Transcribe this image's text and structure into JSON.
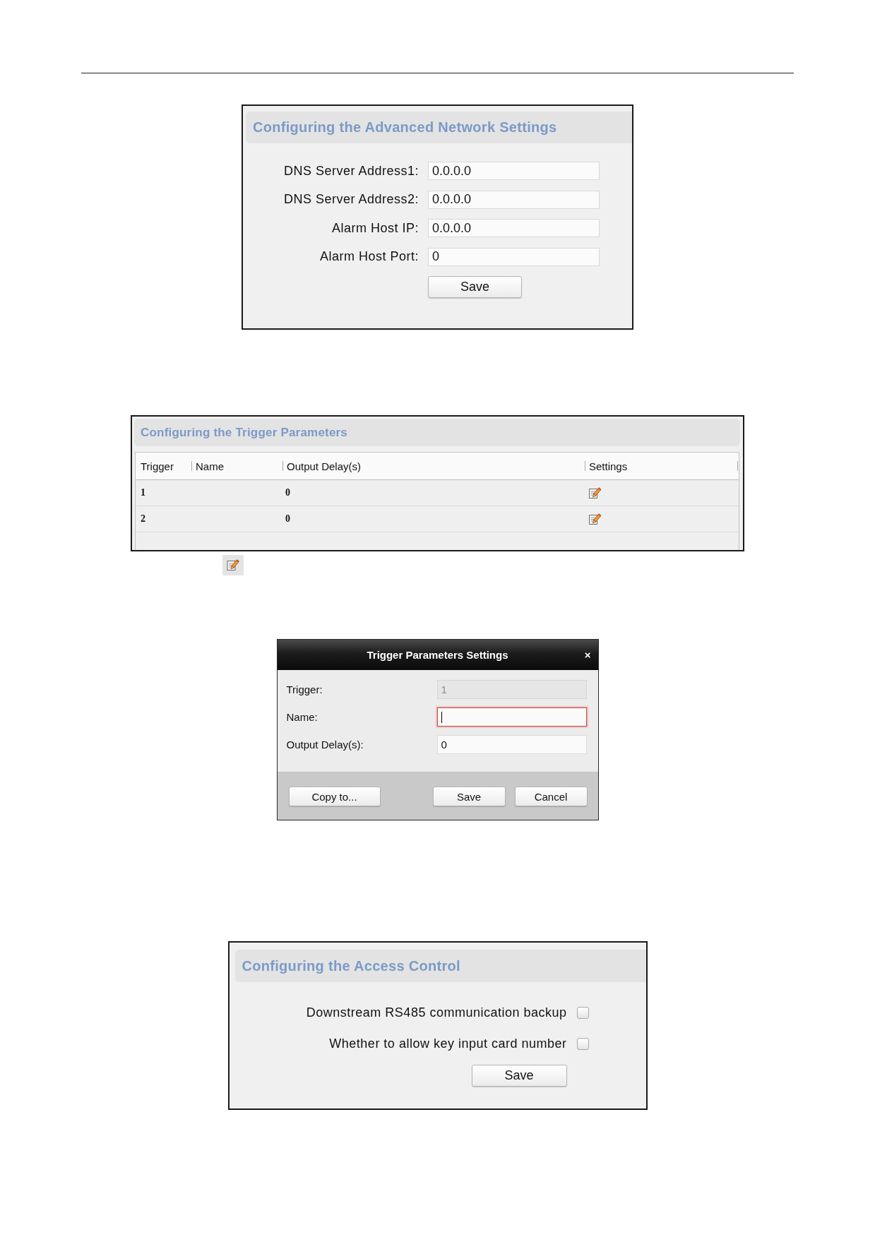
{
  "network_settings": {
    "title": "Configuring the Advanced Network Settings",
    "fields": [
      {
        "label": "DNS Server Address1:",
        "value": "0.0.0.0"
      },
      {
        "label": "DNS Server Address2:",
        "value": "0.0.0.0"
      },
      {
        "label": "Alarm Host IP:",
        "value": "0.0.0.0"
      },
      {
        "label": "Alarm Host Port:",
        "value": "0"
      }
    ],
    "save_button": "Save"
  },
  "trigger_parameters": {
    "title": "Configuring the Trigger Parameters",
    "table": {
      "columns": [
        "Trigger",
        "Name",
        "Output Delay(s)",
        "Settings"
      ],
      "rows": [
        {
          "trigger": "1",
          "output_delay": "0"
        },
        {
          "trigger": "2",
          "output_delay": "0"
        }
      ]
    }
  },
  "trigger_dialog": {
    "title": "Trigger Parameters Settings",
    "close_button": "×",
    "fields": [
      {
        "label": "Trigger:",
        "value": "1",
        "disabled": true,
        "invalid": false,
        "focused": false
      },
      {
        "label": "Name:",
        "disabled": false,
        "invalid": true,
        "focused": true
      },
      {
        "label": "Output Delay(s):",
        "value": "0",
        "disabled": false,
        "invalid": false,
        "focused": false
      }
    ],
    "left_buttons": [
      "Copy to..."
    ],
    "right_buttons": [
      "Save",
      "Cancel"
    ]
  },
  "access_control": {
    "title": "Configuring the Access Control",
    "options": [
      {
        "label": "Downstream RS485 communication backup",
        "checked": false
      },
      {
        "label": "Whether to allow key input card number",
        "checked": false
      }
    ],
    "save_button": "Save"
  }
}
